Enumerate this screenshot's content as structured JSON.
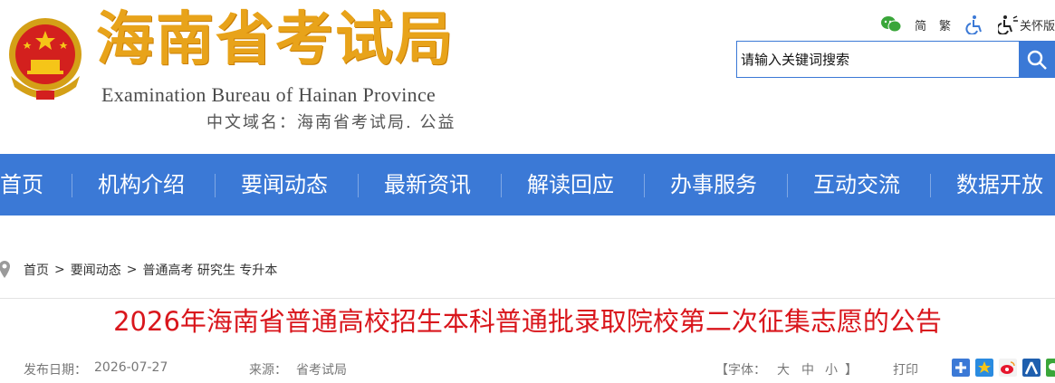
{
  "header": {
    "title": "海南省考试局",
    "subtitle_en": "Examination Bureau of Hainan Province",
    "domain_label": "中文域名：海南省考试局. 公益"
  },
  "tools": {
    "simplified": "简",
    "traditional": "繁",
    "care_label": "关怀版"
  },
  "search": {
    "placeholder": "请输入关键词搜索"
  },
  "nav": {
    "items": [
      "首页",
      "机构介绍",
      "要闻动态",
      "最新资讯",
      "解读回应",
      "办事服务",
      "互动交流",
      "数据开放"
    ]
  },
  "breadcrumb": {
    "home": "首页",
    "section": "要闻动态",
    "sub": "普通高考 研究生 专升本",
    "sep": ">"
  },
  "article": {
    "title": "2026年海南省普通高校招生本科普通批录取院校第二次征集志愿的公告",
    "date_label": "发布日期：",
    "date": "2026-07-27",
    "source_label": "来源：",
    "source": "省考试局",
    "font_size_label": "【字体：",
    "font_large": "大",
    "font_medium": "中",
    "font_small": "小",
    "font_close": "】",
    "print_label": "打印"
  },
  "colors": {
    "nav_bg": "#3b79d6",
    "title_red": "#d9161c",
    "logo_gold": "#e8a31a"
  }
}
